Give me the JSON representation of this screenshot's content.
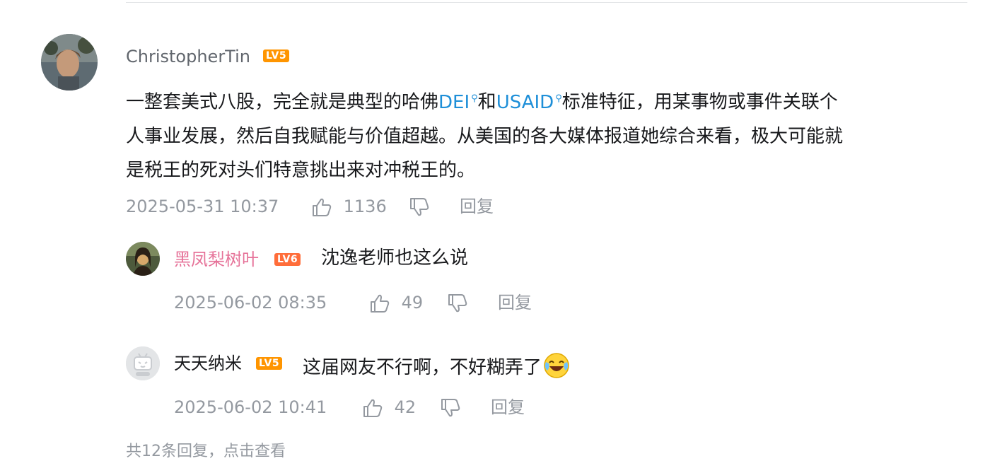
{
  "comment": {
    "user": {
      "name": "ChristopherTin",
      "level": "LV5",
      "level_color": "#ff9500"
    },
    "text_parts": [
      "一整套美式八股，完全就是典型的哈佛",
      "DEI",
      "和",
      "USAID",
      "标准特征，用某事物或事件关联个",
      "人事业发展，然后自我赋能与价值超越。从美国的各大媒体报道她综合来看，极大可能就",
      "是税王的死对头们特意挑出来对冲税王的。"
    ],
    "timestamp": "2025-05-31 10:37",
    "likes": "1136",
    "reply_label": "回复"
  },
  "replies": [
    {
      "user": {
        "name": "黑凤梨树叶",
        "level": "LV6",
        "name_color": "#e67399",
        "level_color": "#ff6d3a"
      },
      "text": "沈逸老师也这么说",
      "timestamp": "2025-06-02 08:35",
      "likes": "49",
      "reply_label": "回复"
    },
    {
      "user": {
        "name": "天天纳米",
        "level": "LV5",
        "name_color": "#18191c",
        "level_color": "#ff9500"
      },
      "text": "这届网友不行啊，不好糊弄了",
      "emoji": "laughing-crying-emoji",
      "timestamp": "2025-06-02 10:41",
      "likes": "42",
      "reply_label": "回复"
    }
  ],
  "more_replies_text": "共12条回复，点击查看",
  "colors": {
    "keyword": "#1e8fd8",
    "meta": "#9499a0",
    "text": "#18191c"
  }
}
